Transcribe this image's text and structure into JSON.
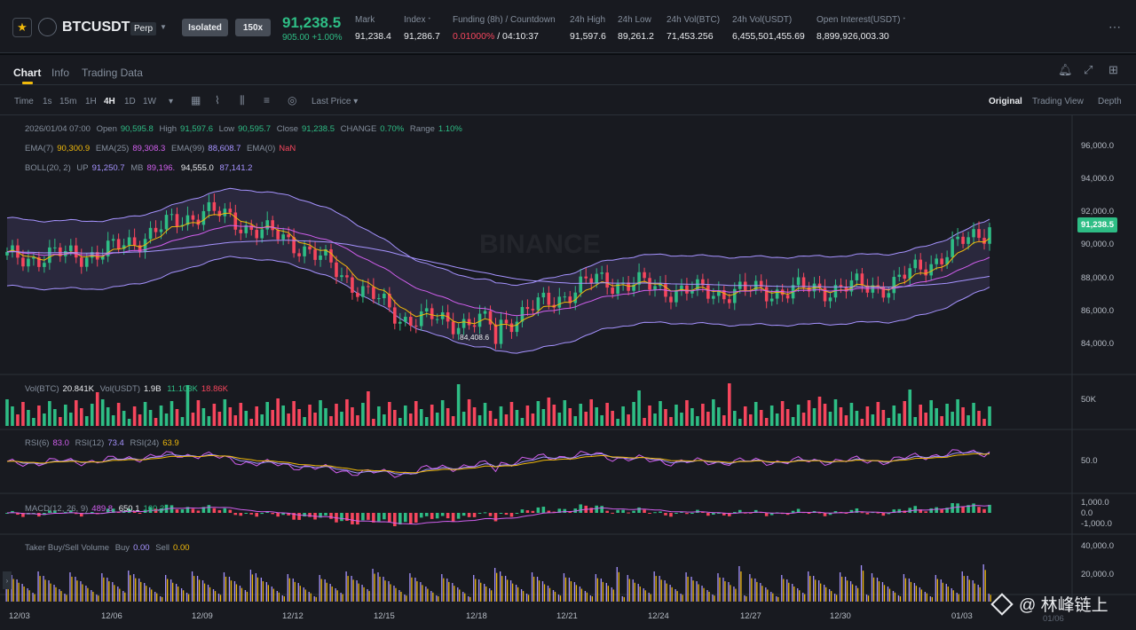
{
  "header": {
    "symbol": "BTCUSDT",
    "contract_type": "Perp",
    "margin_mode": "Isolated",
    "leverage": "150x",
    "last_price": "91,238.5",
    "change": "905.00 +1.00%",
    "stats": [
      {
        "label": "Mark",
        "value": "91,238.4"
      },
      {
        "label": "Index",
        "value": "91,286.7"
      },
      {
        "label": "Funding (8h) / Countdown",
        "value_rate": "0.01000%",
        "value_countdown": "/ 04:10:37"
      },
      {
        "label": "24h High",
        "value": "91,597.6"
      },
      {
        "label": "24h Low",
        "value": "89,261.2"
      },
      {
        "label": "24h Vol(BTC)",
        "value": "71,453.256"
      },
      {
        "label": "24h Vol(USDT)",
        "value": "6,455,501,455.69"
      },
      {
        "label": "Open Interest(USDT)",
        "value": "8,899,926,003.30"
      }
    ]
  },
  "tabs": [
    "Chart",
    "Info",
    "Trading Data"
  ],
  "toolbar": {
    "intervals": [
      "Time",
      "1s",
      "15m",
      "1H",
      "4H",
      "1D",
      "1W"
    ],
    "active_interval": "4H",
    "price_type": "Last Price",
    "views": [
      "Original",
      "Trading View",
      "Depth"
    ],
    "active_view": "Original"
  },
  "legend": {
    "ohlc": {
      "date": "2026/01/04 07:00",
      "open_label": "Open",
      "open": "90,595.8",
      "high_label": "High",
      "high": "91,597.6",
      "low_label": "Low",
      "low": "90,595.7",
      "close_label": "Close",
      "close": "91,238.5",
      "change_label": "CHANGE",
      "change": "0.70%",
      "range_label": "Range",
      "range": "1.10%"
    },
    "ema": [
      {
        "label": "EMA(7)",
        "value": "90,300.9",
        "color": "#f0b90b"
      },
      {
        "label": "EMA(25)",
        "value": "89,308.3",
        "color": "#d15fee"
      },
      {
        "label": "EMA(99)",
        "value": "88,608.7",
        "color": "#a693ff"
      },
      {
        "label": "EMA(0)",
        "value": "NaN",
        "color": "#f6465d"
      }
    ],
    "boll": {
      "label": "BOLL(20, 2)",
      "up_label": "UP",
      "up": "91,250.7",
      "mb_label": "MB",
      "mb": "89,196.",
      "dn": "87,141.2",
      "marker": "94,555.0"
    },
    "volume": {
      "label": "Vol(BTC)",
      "value": "20.841K",
      "usdt_label": "Vol(USDT)",
      "usdt": "1.9B",
      "ma1": "11.103K",
      "ma2": "18.86K"
    },
    "rsi": [
      {
        "label": "RSI(6)",
        "value": "83.0",
        "color": "#d15fee"
      },
      {
        "label": "RSI(12)",
        "value": "73.4",
        "color": "#a693ff"
      },
      {
        "label": "RSI(24)",
        "value": "63.9",
        "color": "#f0b90b"
      }
    ],
    "macd": {
      "label": "MACD(12, 26, 9)",
      "v1": "489.8",
      "v2": "650.1",
      "v3": "160.3"
    },
    "taker": {
      "label": "Taker Buy/Sell Volume",
      "buy_label": "Buy",
      "buy": "0.00",
      "sell_label": "Sell",
      "sell": "0.00"
    }
  },
  "axes": {
    "price_ticks": [
      "96,000.0",
      "94,000.0",
      "92,000.0",
      "90,000.0",
      "88,000.0",
      "86,000.0",
      "84,000.0"
    ],
    "vol_tick": "50K",
    "rsi_tick": "50.0",
    "macd_ticks": [
      "1,000.0",
      "0.0",
      "-1,000.0"
    ],
    "taker_ticks": [
      "40,000.0",
      "20,000.0"
    ],
    "dates": [
      "12/03",
      "12/06",
      "12/09",
      "12/12",
      "12/15",
      "12/18",
      "12/21",
      "12/24",
      "12/27",
      "12/30",
      "01/03"
    ],
    "date_extra": "01/06",
    "current_price": "91,238.5",
    "low_marker": "84,408.6"
  },
  "chart_data": {
    "type": "candlestick",
    "interval": "4H",
    "y_range": [
      83000,
      97500
    ],
    "last_close": 91238.5,
    "period_low": 84408.6,
    "series_anchor_closes": [
      {
        "date": "12/03",
        "close": 89500
      },
      {
        "date": "12/06",
        "close": 89800
      },
      {
        "date": "12/09",
        "close": 92200
      },
      {
        "date": "12/12",
        "close": 90200
      },
      {
        "date": "12/15",
        "close": 86200
      },
      {
        "date": "12/18",
        "close": 85800
      },
      {
        "date": "12/21",
        "close": 88300
      },
      {
        "date": "12/24",
        "close": 87600
      },
      {
        "date": "12/27",
        "close": 87700
      },
      {
        "date": "12/30",
        "close": 88000
      },
      {
        "date": "01/03",
        "close": 91238.5
      }
    ]
  },
  "watermark": "@ 林峰链上",
  "chart_watermark": "BINANCE",
  "colors": {
    "up": "#2ebd85",
    "down": "#f6465d",
    "accent": "#f0b90b",
    "bg": "#181a20"
  }
}
